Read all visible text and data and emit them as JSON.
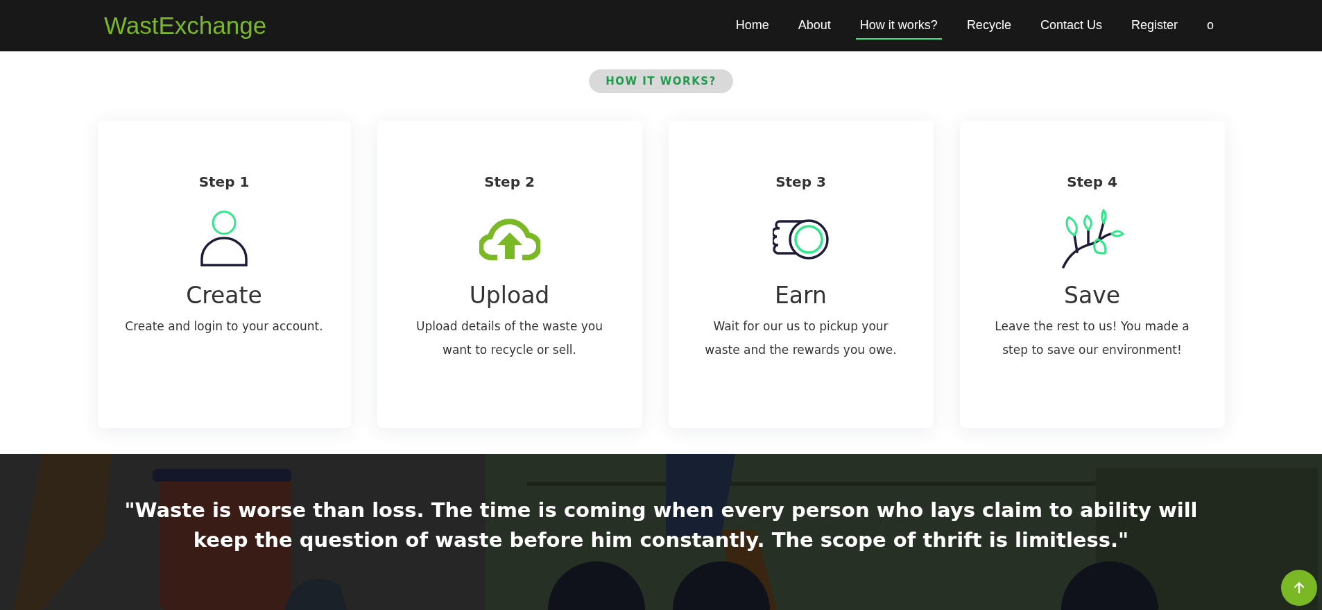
{
  "logo": "WastExchange",
  "nav": [
    {
      "label": "Home",
      "selected": false
    },
    {
      "label": "About",
      "selected": false
    },
    {
      "label": "How it works?",
      "selected": true
    },
    {
      "label": "Recycle",
      "selected": false
    },
    {
      "label": "Contact Us",
      "selected": false
    },
    {
      "label": "Register",
      "selected": false
    },
    {
      "label": "o",
      "selected": false
    }
  ],
  "section_badge": "HOW IT WORKS?",
  "steps": [
    {
      "step": "Step 1",
      "kind": "person",
      "title": "Create",
      "description": "Create and login to your account."
    },
    {
      "step": "Step 2",
      "kind": "cloud",
      "title": "Upload",
      "description": "Upload details of the waste you want to recycle or sell."
    },
    {
      "step": "Step 3",
      "kind": "coins",
      "title": "Earn",
      "description": "Wait for our us to pickup your waste and the rewards you owe."
    },
    {
      "step": "Step 4",
      "kind": "branch",
      "title": "Save",
      "description": "Leave the rest to us! You made a step to save our environment!"
    }
  ],
  "banner": {
    "kind": "picture",
    "quote": "\"Waste is worse than loss. The time is coming when every person who lays claim to ability will keep the question of waste before him constantly. The scope of thrift is limitless.\""
  }
}
